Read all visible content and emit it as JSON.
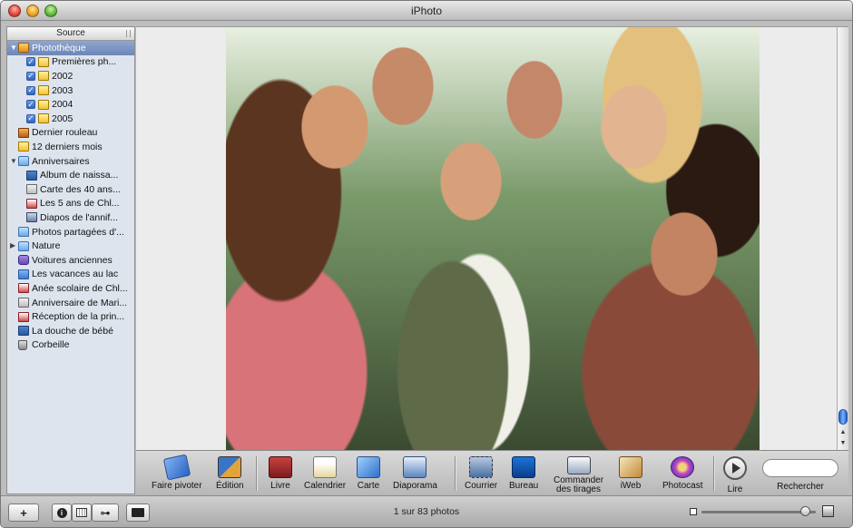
{
  "window": {
    "title": "iPhoto"
  },
  "sidebar": {
    "header": "Source",
    "items": [
      {
        "label": "Photothèque",
        "icon": "photo-library-icon",
        "indent": 0,
        "expander": "expanded",
        "selected": true
      },
      {
        "label": "Premières ph...",
        "icon": "event-icon",
        "indent": 2,
        "checked": true
      },
      {
        "label": "2002",
        "icon": "event-icon",
        "indent": 2,
        "checked": true
      },
      {
        "label": "2003",
        "icon": "event-icon",
        "indent": 2,
        "checked": true
      },
      {
        "label": "2004",
        "icon": "event-icon",
        "indent": 2,
        "checked": true
      },
      {
        "label": "2005",
        "icon": "event-icon",
        "indent": 2,
        "checked": true
      },
      {
        "label": "Dernier rouleau",
        "icon": "film-roll-icon",
        "indent": 1
      },
      {
        "label": "12 derniers mois",
        "icon": "event-icon",
        "indent": 1
      },
      {
        "label": "Anniversaires",
        "icon": "folder-icon",
        "indent": 0,
        "expander": "expanded"
      },
      {
        "label": "Album de naissa...",
        "icon": "book-icon",
        "indent": 2
      },
      {
        "label": "Carte des 40 ans...",
        "icon": "card-icon",
        "indent": 2
      },
      {
        "label": "Les 5 ans de Chl...",
        "icon": "calendar-icon",
        "indent": 2
      },
      {
        "label": "Diapos de l'annif...",
        "icon": "slideshow-icon",
        "indent": 2
      },
      {
        "label": "Photos partagées d'...",
        "icon": "folder-icon",
        "indent": 1
      },
      {
        "label": "Nature",
        "icon": "folder-icon",
        "indent": 0,
        "expander": "collapsed"
      },
      {
        "label": "Voitures anciennes",
        "icon": "smart-album-icon",
        "indent": 1
      },
      {
        "label": "Les vacances au lac",
        "icon": "album-icon",
        "indent": 1
      },
      {
        "label": "Anée scolaire de Chl...",
        "icon": "calendar-icon",
        "indent": 1
      },
      {
        "label": "Anniversaire de Mari...",
        "icon": "card-icon",
        "indent": 1
      },
      {
        "label": "Réception de la prin...",
        "icon": "calendar-icon",
        "indent": 1
      },
      {
        "label": "La douche de bébé",
        "icon": "book-icon",
        "indent": 1
      },
      {
        "label": "Corbeille",
        "icon": "trash-icon",
        "indent": 1
      }
    ]
  },
  "toolbar": {
    "rotate": "Faire pivoter",
    "edit": "Édition",
    "book": "Livre",
    "calendar": "Calendrier",
    "card": "Carte",
    "slideshow": "Diaporama",
    "mail": "Courrier",
    "desktop": "Bureau",
    "order_prints_1": "Commander",
    "order_prints_2": "des tirages",
    "iweb": "iWeb",
    "photocast": "Photocast",
    "play": "Lire",
    "search_label": "Rechercher",
    "search_value": ""
  },
  "status": {
    "text": "1 sur 83 photos"
  },
  "zoom": {
    "value": 0.95
  },
  "colors": {
    "selection": "#6c86b8",
    "scroll_thumb": "#1a5fd0"
  }
}
